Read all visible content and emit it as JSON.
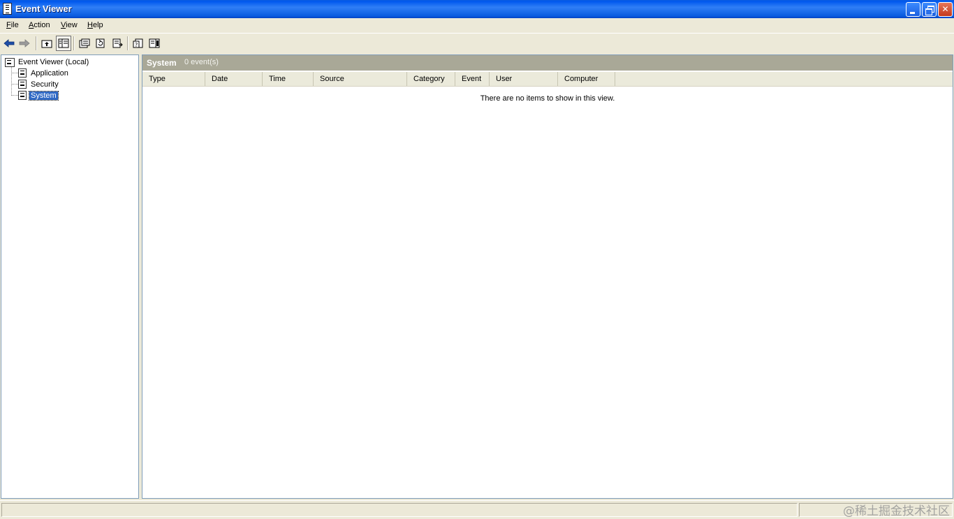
{
  "window": {
    "title": "Event Viewer"
  },
  "menu": {
    "items": [
      "File",
      "Action",
      "View",
      "Help"
    ]
  },
  "toolbar": {
    "buttons": [
      "back-arrow-icon",
      "forward-arrow-icon",
      "up-folder-icon",
      "show-hide-tree-icon",
      "properties-icon",
      "refresh-icon",
      "export-list-icon",
      "help-icon",
      "show-hide-action-pane-icon"
    ]
  },
  "tree": {
    "root": "Event Viewer (Local)",
    "items": [
      "Application",
      "Security",
      "System"
    ],
    "selected": "System"
  },
  "pane": {
    "title": "System",
    "count": "0 event(s)",
    "columns": [
      "Type",
      "Date",
      "Time",
      "Source",
      "Category",
      "Event",
      "User",
      "Computer"
    ],
    "empty_message": "There are no items to show in this view."
  },
  "watermark": "@稀土掘金技术社区",
  "colors": {
    "titlebar": "#0058ee",
    "selection": "#316ac5",
    "header": "#a9a897",
    "chrome": "#ece9d8"
  }
}
